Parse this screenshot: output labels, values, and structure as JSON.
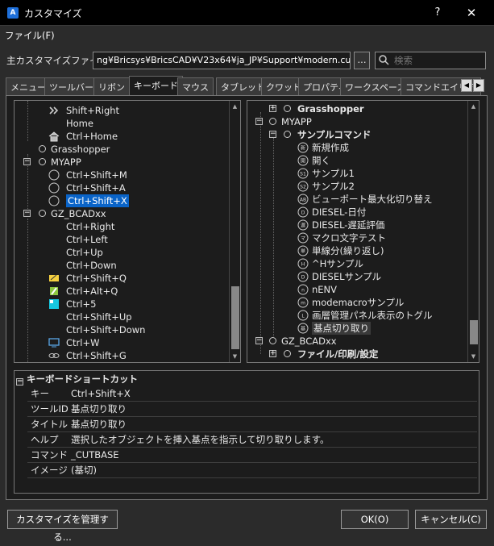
{
  "window": {
    "title": "カスタマイズ",
    "help": "?",
    "close": "✕",
    "app_icon": "A"
  },
  "menu": {
    "file": "ファイル(F)"
  },
  "main_file": {
    "label": "主カスタマイズファイル:",
    "value": "ng¥Bricsys¥BricsCAD¥V23x64¥ja_JP¥Support¥modern.cui",
    "browse": "...",
    "search_placeholder": "検索"
  },
  "tabs": [
    "メニュー",
    "ツールバー",
    "リボン",
    "キーボード",
    "マウス",
    "タブレット",
    "クワッド",
    "プロパティ",
    "ワークスペース",
    "コマンドエイリア"
  ],
  "active_tab": "キーボード",
  "left_tree": [
    {
      "label": "Shift+Right",
      "icon": "double-chevron-right-icon"
    },
    {
      "label": "Home",
      "icon": ""
    },
    {
      "label": "Ctrl+Home",
      "icon": "house-icon"
    },
    {
      "label": "Grasshopper",
      "icon": "circle-node-icon"
    },
    {
      "label": "MYAPP",
      "icon": "circle-node-icon",
      "expander": "−"
    },
    {
      "label": "Ctrl+Shift+M",
      "icon": "command-icon"
    },
    {
      "label": "Ctrl+Shift+A",
      "icon": "command-icon"
    },
    {
      "label": "Ctrl+Shift+X",
      "icon": "command-icon",
      "selected": true
    },
    {
      "label": "GZ_BCADxx",
      "icon": "circle-node-icon",
      "expander": "−"
    },
    {
      "label": "Ctrl+Right",
      "icon": ""
    },
    {
      "label": "Ctrl+Left",
      "icon": ""
    },
    {
      "label": "Ctrl+Up",
      "icon": ""
    },
    {
      "label": "Ctrl+Down",
      "icon": ""
    },
    {
      "label": "Ctrl+Shift+Q",
      "icon": "pencil-icon"
    },
    {
      "label": "Ctrl+Alt+Q",
      "icon": "brush-icon"
    },
    {
      "label": "Ctrl+5",
      "icon": "cyan-square-icon"
    },
    {
      "label": "Ctrl+Shift+Up",
      "icon": ""
    },
    {
      "label": "Ctrl+Shift+Down",
      "icon": ""
    },
    {
      "label": "Ctrl+W",
      "icon": "monitor-icon"
    },
    {
      "label": "Ctrl+Shift+G",
      "icon": "link-icon"
    }
  ],
  "right_tree": [
    {
      "label": "Grasshopper",
      "bold": true,
      "expander": "+"
    },
    {
      "label": "MYAPP",
      "expander": "−"
    },
    {
      "label": "サンプルコマンド",
      "bold": true,
      "expander": "−"
    },
    {
      "label": "新規作成",
      "icon": "command-icon"
    },
    {
      "label": "開く",
      "icon": "command-icon"
    },
    {
      "label": "サンプル1",
      "icon": "command-icon"
    },
    {
      "label": "サンプル2",
      "icon": "command-icon"
    },
    {
      "label": "ビューポート最大化切り替え",
      "icon": "command-icon"
    },
    {
      "label": "DIESEL-日付",
      "icon": "command-icon"
    },
    {
      "label": "DIESEL-遅延評価",
      "icon": "command-icon"
    },
    {
      "label": "マクロ文字テスト",
      "icon": "command-icon"
    },
    {
      "label": "単線分(繰り返し)",
      "icon": "command-icon"
    },
    {
      "label": "^Hサンプル",
      "icon": "command-icon"
    },
    {
      "label": "DIESELサンプル",
      "icon": "command-icon"
    },
    {
      "label": "nENV",
      "icon": "command-icon"
    },
    {
      "label": "modemacroサンプル",
      "icon": "command-icon"
    },
    {
      "label": "画層管理パネル表示のトグル",
      "icon": "command-icon"
    },
    {
      "label": "基点切り取り",
      "icon": "command-icon",
      "highlighted": true
    },
    {
      "label": "GZ_BCADxx",
      "expander": "−"
    },
    {
      "label": "ファイル/印刷/設定",
      "bold": true,
      "expander": "+"
    }
  ],
  "right_icon_glyphs": [
    "新",
    "開",
    "S1",
    "S2",
    "AB",
    "D",
    "遅",
    "マ",
    "単",
    "H",
    "D",
    "n",
    "m",
    "L",
    "基"
  ],
  "properties": {
    "header": "キーボードショートカット",
    "rows": [
      {
        "key": "キー",
        "value": "Ctrl+Shift+X"
      },
      {
        "key": "ツールID",
        "value": "基点切り取り"
      },
      {
        "key": "タイトル",
        "value": "基点切り取り"
      },
      {
        "key": "ヘルプ",
        "value": "選択したオブジェクトを挿入基点を指示して切り取りします。"
      },
      {
        "key": "コマンド",
        "value": "_CUTBASE"
      },
      {
        "key": "イメージ",
        "value": "(基切)"
      }
    ]
  },
  "buttons": {
    "manage": "カスタマイズを管理する...",
    "ok": "OK(O)",
    "cancel": "キャンセル(C)"
  },
  "colors": {
    "selection": "#0a64c8",
    "background": "#2b2b2b",
    "panel": "#1c1c1c"
  }
}
